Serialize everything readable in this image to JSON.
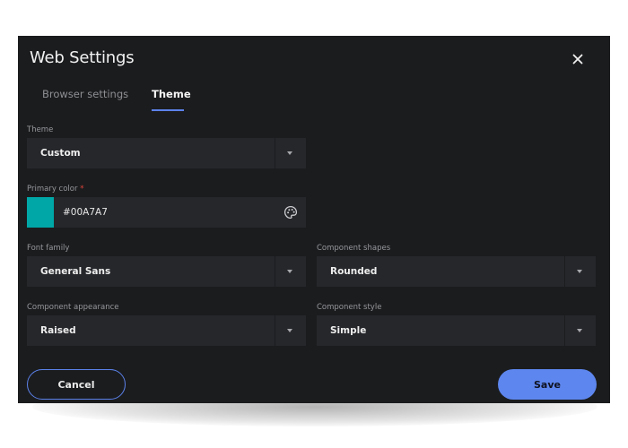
{
  "dialog": {
    "title": "Web Settings",
    "close_icon": "close-icon"
  },
  "tabs": [
    {
      "label": "Browser settings",
      "active": false
    },
    {
      "label": "Theme",
      "active": true
    }
  ],
  "form": {
    "theme": {
      "label": "Theme",
      "value": "Custom"
    },
    "primary_color": {
      "label": "Primary color",
      "required_mark": "*",
      "value": "#00A7A7",
      "swatch_color": "#00A7A7",
      "icon": "palette-icon"
    },
    "font_family": {
      "label": "Font family",
      "value": "General Sans"
    },
    "component_shapes": {
      "label": "Component shapes",
      "value": "Rounded"
    },
    "component_appearance": {
      "label": "Component appearance",
      "value": "Raised"
    },
    "component_style": {
      "label": "Component style",
      "value": "Simple"
    }
  },
  "buttons": {
    "cancel": "Cancel",
    "save": "Save"
  },
  "colors": {
    "accent": "#5C82EA",
    "background": "#1B1C1E",
    "field": "#26272B"
  }
}
